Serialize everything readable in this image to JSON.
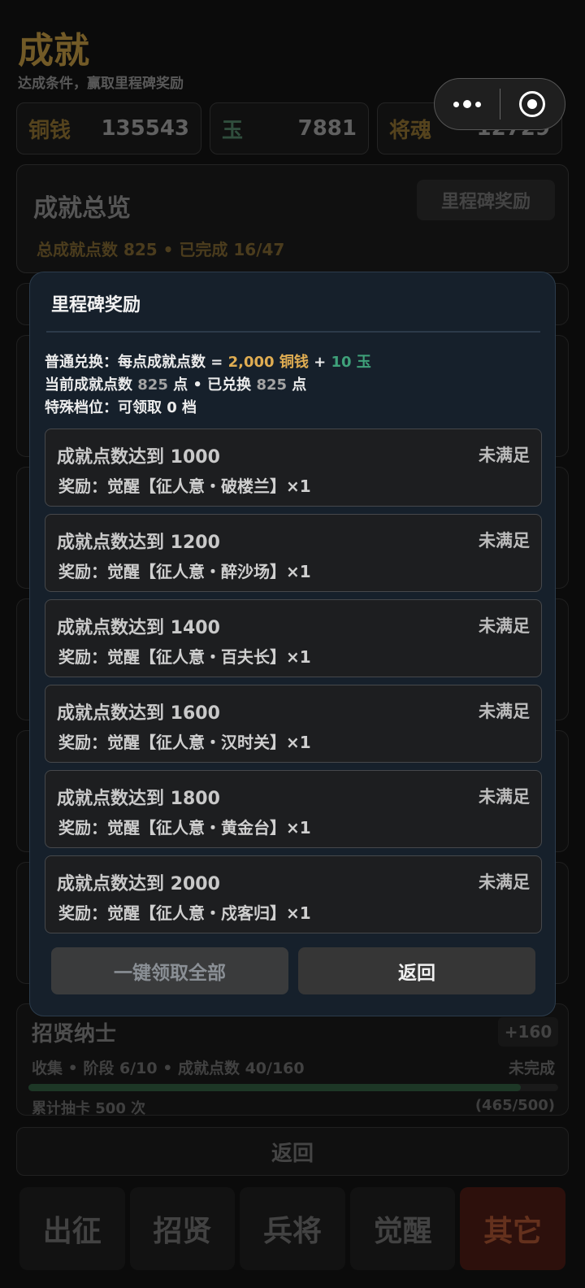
{
  "header": {
    "title": "成就",
    "subtitle": "达成条件，赢取里程碑奖励"
  },
  "currencies": [
    {
      "name": "铜钱",
      "value": "135543"
    },
    {
      "name": "玉",
      "value": "7881"
    },
    {
      "name": "将魂",
      "value": "12729"
    }
  ],
  "overview": {
    "title": "成就总览",
    "milestone_button": "里程碑奖励",
    "stats": "总成就点数 825 • 已完成 16/47"
  },
  "recruit_card": {
    "title": "招贤纳士",
    "points": "+160",
    "meta": "收集 • 阶段 6/10 • 成就点数 40/160",
    "status": "未完成",
    "progress_fraction": 0.93,
    "task": "累计抽卡 500 次",
    "task_progress": "(465/500)"
  },
  "bottom_back_label": "返回",
  "tabs": [
    {
      "label": "出征",
      "active": false
    },
    {
      "label": "招贤",
      "active": false
    },
    {
      "label": "兵将",
      "active": false
    },
    {
      "label": "觉醒",
      "active": false
    },
    {
      "label": "其它",
      "active": true
    }
  ],
  "modal": {
    "title": "里程碑奖励",
    "exchange": {
      "prefix": "普通兑换：每点成就点数 = ",
      "copper": "2,000 铜钱",
      "plus": " + ",
      "jade": "10 玉"
    },
    "current": {
      "label1": "当前成就点数 ",
      "points": "825",
      "label2": " 点 • 已兑换 ",
      "exchanged": "825",
      "label3": " 点"
    },
    "special": "特殊档位：可领取 0 档",
    "milestones": [
      {
        "condition": "成就点数达到 1000",
        "status": "未满足",
        "reward": "奖励：觉醒【征人意・破楼兰】×1"
      },
      {
        "condition": "成就点数达到 1200",
        "status": "未满足",
        "reward": "奖励：觉醒【征人意・醉沙场】×1"
      },
      {
        "condition": "成就点数达到 1400",
        "status": "未满足",
        "reward": "奖励：觉醒【征人意・百夫长】×1"
      },
      {
        "condition": "成就点数达到 1600",
        "status": "未满足",
        "reward": "奖励：觉醒【征人意・汉时关】×1"
      },
      {
        "condition": "成就点数达到 1800",
        "status": "未满足",
        "reward": "奖励：觉醒【征人意・黄金台】×1"
      },
      {
        "condition": "成就点数达到 2000",
        "status": "未满足",
        "reward": "奖励：觉醒【征人意・戍客归】×1"
      }
    ],
    "claim_all_label": "一键领取全部",
    "back_label": "返回"
  }
}
